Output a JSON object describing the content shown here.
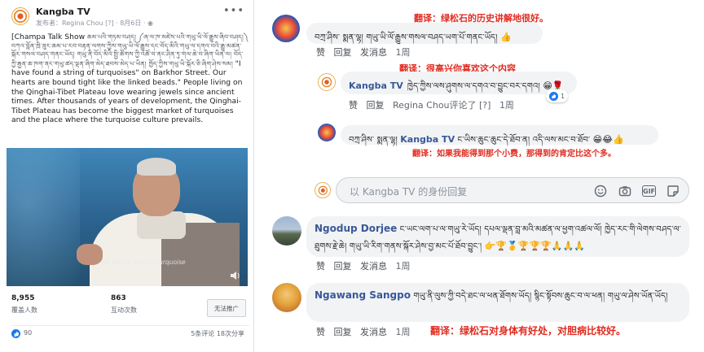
{
  "post": {
    "page_name": "Kangba TV",
    "meta": "发布者：Regina Chou [?] · 8月6日 · ",
    "text_lead": "[Champa Talk Show ",
    "text_tib": "ཆམ་པའི་གཏམ་བཤད། ༼ཞ་ལ་ཁ་མཛེས་པའི་གཡུ་ཡི་ལོ་རྒྱུས་ཞིབ་བཤད།༽ བཀའ་བློན་ཁྲི་ཟུར་ཆམ་པ་རབ་བརྟན་ལགས་ཀྱིས་གཡུ་ཡི་ལོ་རྒྱུས་དང་བོད་མིའི་གཡུ་ལ་དགའ་བའི་རྒྱུ་མཚན་སྐོར་གསལ་བཤད་གནང་ཡོད། གཡུ་ནི་བོད་མིའི་སྤྱི་ཚོགས་ཀྱི་འཚོ་བ་ནང་ཤིན་ཏུ་གལ་ཆེ་བ་ཞིག་ཡིན་ལ། བོད་ཀྱི་རྒྱན་ཆ་ཁག་ནང་གཡུ་ཚད་ལྡན་ཞིག་མེད་ཐབས་མེད་པ་ཡིན། ཁྱོད་ཀྱིས་གཡུ་ཡི་སྐོར་ཅི་ཞིག་ཤེས་སམ། ",
    "text_en": "\"I have found a string of turquoises\" on Barkhor Street. Our hearts are bound tight like the linked beads.\" People living on the Qinghai-Tibet Plateau love wearing jewels since ancient times. After thousands of years of development, the Qinghai-Tibet Plateau has become the biggest market of turquoises and the place where the turquoise culture prevails.",
    "video_caption": "we take a natural turquoise",
    "reach_num": "8,955",
    "reach_label": "覆盖人数",
    "engage_num": "863",
    "engage_label": "互动次数",
    "boost_label": "无法推广",
    "likes": "90",
    "foot_right": "5条评论 18次分享"
  },
  "comments": {
    "c1": {
      "text": "བཀྲ་ཤིས་ སྨན་ལྷ། གཡུ་ཡི་ལོ་རྒྱུས་གསལ་བཤད་ཡག་པོ་གནང་ཡོད། ",
      "emoji": "👍",
      "translation": "翻译：绿松石的历史讲解地很好。",
      "like": "赞",
      "reply": "回复",
      "message": "发消息",
      "time": "1周"
    },
    "c2": {
      "name": "Kangba TV",
      "text": "ཁྱེད་ཀྱིས་ལས་ཤུགས་ལ་དགའ་བ་བྱུང་བར་དགའ། ",
      "emoji": "😁🌹",
      "translation": "翻译：很高兴你喜欢这个内容",
      "reaction_count": "1",
      "like": "赞",
      "reply": "回复",
      "commented_by": "Regina Chou评论了 [?]",
      "time": "1周"
    },
    "c3": {
      "prefix": "བཀྲ་ཤིས་ སྨན་ལྷ། ",
      "name": "Kangba TV",
      "text": " ང་ཡིས་ཆུང་ཆུང་དེ་ཐོབ་ན། འདི་ལས་མང་བ་ཐོབ་ ",
      "emoji": "😁😂👍",
      "translation": "翻译：如果我能得到那个小费，那得到的肯定比这个多。"
    },
    "reply_box": {
      "placeholder": "以 Kangba TV 的身份回复",
      "icons": [
        "smiley-icon",
        "camera-icon",
        "gif-icon",
        "sticker-icon"
      ]
    },
    "c4": {
      "name": "Ngodup Dorjee",
      "text": " ང་ཡང་ལག་པ་ལ་གཡུ་རེ་ཡོད། དཔལ་ལྡན་བླ་མའི་མཚན་ལ་ཕྱག་འཚལ་ལོ། ཁྱེད་རང་གི་ལེགས་བཤད་ལ་ཐུགས་རྗེ་ཆེ། གཡུ་ཡི་རིག་གནས་སྐོར་ཤེས་བྱ་མང་པོ་ཐོབ་བྱུང་། ",
      "emoji": "👉🏆🥇🏆🏆🏆🙏🙏🙏",
      "like": "赞",
      "reply": "回复",
      "message": "发消息",
      "time": "1周"
    },
    "c5": {
      "name": "Ngawang Sangpo",
      "text": " གཡུ་ནི་ལུས་ཀྱི་བདེ་ཐང་ལ་ཕན་ཐོགས་ཡོད། སྙིང་སྟོབས་ཆུང་བ་ལ་ཕན། གཡུ་ལ་ཤེས་ཡོན་ཡོད། ",
      "translation": "翻译：绿松石对身体有好处，对胆病比较好。",
      "like": "赞",
      "reply": "回复",
      "message": "发消息",
      "time": "1周"
    }
  },
  "colors": {
    "name_blue": "#385898",
    "translation_red": "#e02b20",
    "like_blue": "#1877f2"
  }
}
